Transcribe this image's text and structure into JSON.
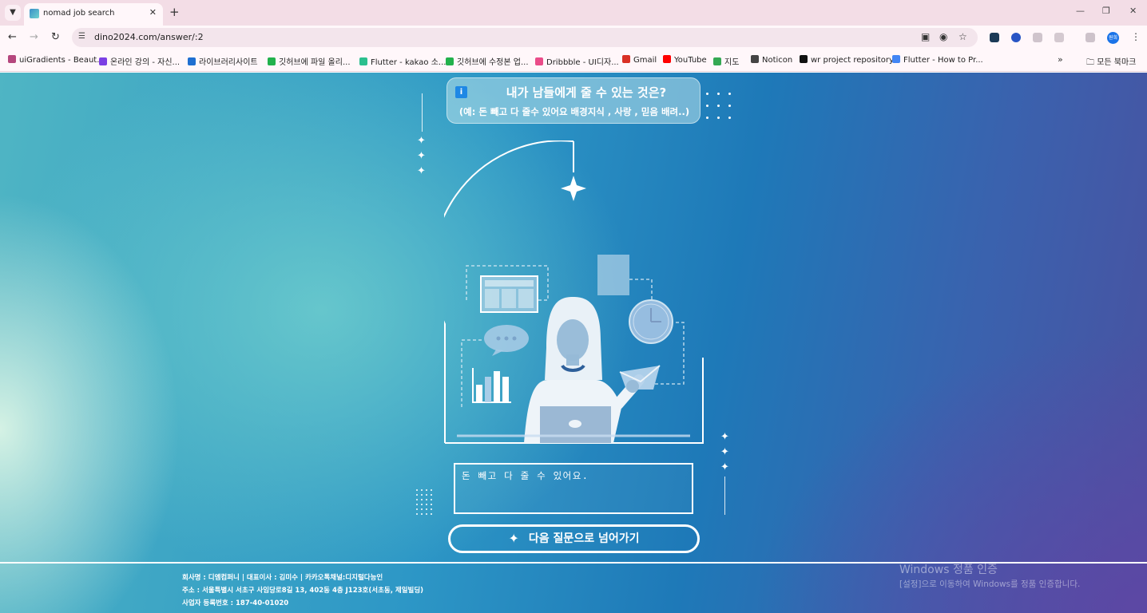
{
  "browser": {
    "tab_title": "nomad job search",
    "tab_list_icon": "chevron-down-icon",
    "new_tab_label": "+",
    "url": "dino2024.com/answer/:2",
    "profile_initials": "원희",
    "bookmarks": [
      {
        "label": "uiGradients - Beaut...",
        "color": "#b5477d"
      },
      {
        "label": "온라인 강의 - 자신...",
        "color": "#7b3fe4"
      },
      {
        "label": "라이브러리사이트",
        "color": "#1f6fd1"
      },
      {
        "label": "깃허브에 파일 올리...",
        "color": "#22b14c"
      },
      {
        "label": "Flutter - kakao 소...",
        "color": "#2bbf8e"
      },
      {
        "label": "깃허브에 수정본 업...",
        "color": "#22b14c"
      },
      {
        "label": "Dribbble - UI디자...",
        "color": "#ea4c89"
      },
      {
        "label": "Gmail",
        "color": "#d93025"
      },
      {
        "label": "YouTube",
        "color": "#ff0000"
      },
      {
        "label": "지도",
        "color": "#34a853"
      },
      {
        "label": "Noticon",
        "color": "#444444"
      },
      {
        "label": "wr project repository",
        "color": "#111111"
      },
      {
        "label": "Flutter - How to Pr...",
        "color": "#4285f4"
      }
    ],
    "all_bookmarks_label": "모든 북마크"
  },
  "question": {
    "title": "내가 남들에게 줄 수 있는 것은?",
    "subtitle": "(예: 돈 빼고 다 줄수 있어요 배경지식 , 사랑 , 믿음 배려..)"
  },
  "answer": {
    "value": "돈 빼고 다 줄 수 있어요."
  },
  "next_button": {
    "label": "다음 질문으로 넘어가기",
    "icon": "sparkle-icon"
  },
  "footer": {
    "company": "회사명 : 디엠컴퍼니 | 대표이사 : 김미수 | 카카오톡채널:디지털다능인",
    "address": "주소 : 서울특별시 서초구 사임당로8길 13, 402동 4층 J123호(서초동, 제일빌딩)",
    "registration": "사업자 등록번호 : 187-40-01020"
  },
  "watermark": {
    "title": "Windows 정품 인증",
    "subtitle": "[설정]으로 이동하여 Windows를 정품 인증합니다."
  }
}
